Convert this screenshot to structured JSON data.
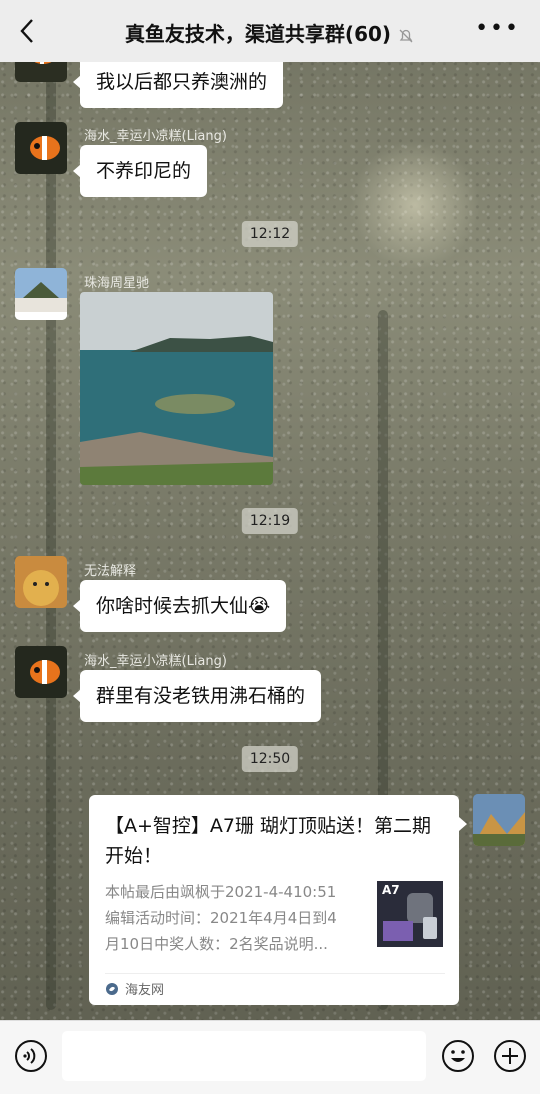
{
  "header": {
    "title": "真鱼友技术，渠道共享群(60)",
    "back_icon": "chevron-left-icon",
    "mute_icon": "bell-off-icon",
    "more_icon": "more-horizontal-icon"
  },
  "messages": [
    {
      "text": "我以后都只养澳洲的"
    },
    {
      "sender": "海水_幸运小凉糕(Liang)",
      "text": "不养印尼的"
    },
    {
      "time": "12:12"
    },
    {
      "sender": "珠海周星驰"
    },
    {
      "time": "12:19"
    },
    {
      "sender": "无法解释",
      "text": "你啥时候去抓大仙",
      "emoji": "😭"
    },
    {
      "sender": "海水_幸运小凉糕(Liang)",
      "text": "群里有没老铁用沸石桶的"
    },
    {
      "time": "12:50"
    }
  ],
  "link_card": {
    "title": "【A+智控】A7珊 瑚灯顶贴送！第二期开始！",
    "desc_lines": [
      "本帖最后由飒枫于2021-4-410:51",
      "编辑活动时间：2021年4月4日到4",
      "月10日中奖人数：2名奖品说明..."
    ],
    "thumb_label": "A7",
    "source": "海友网"
  },
  "bottom": {
    "voice_icon": "voice-icon",
    "emoji_icon": "emoji-icon",
    "plus_icon": "plus-circle-icon"
  }
}
